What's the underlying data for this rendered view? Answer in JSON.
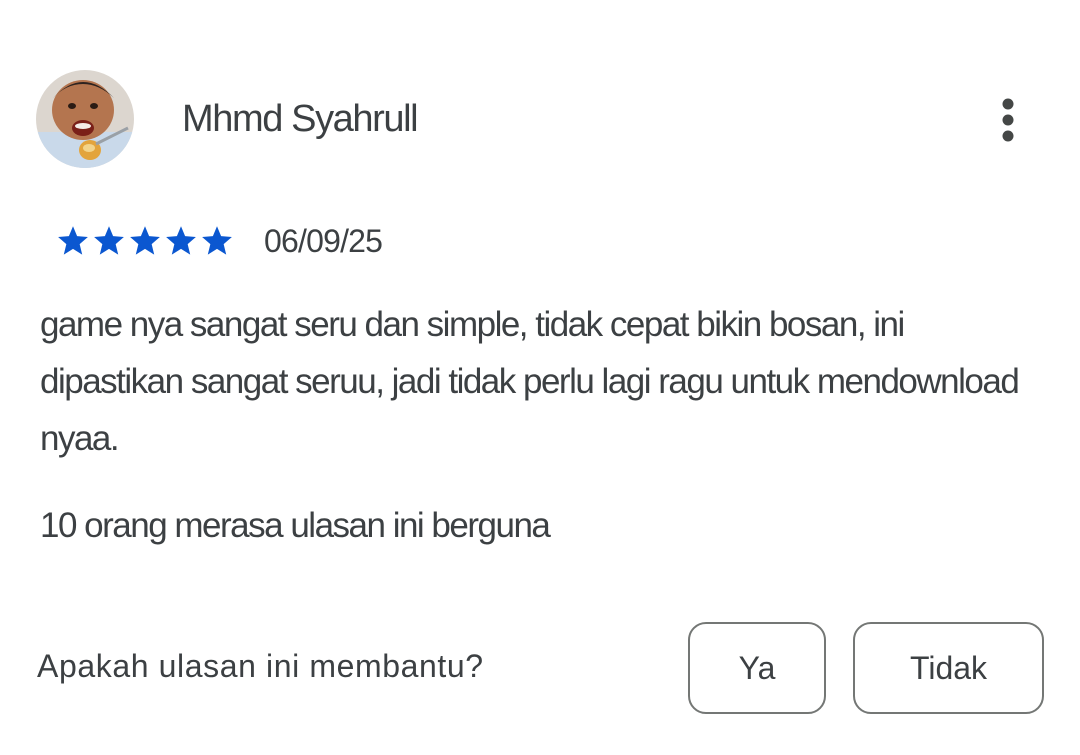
{
  "review": {
    "author_name": "Mhmd Syahrull",
    "rating": 5,
    "rating_max": 5,
    "date": "06/09/25",
    "text": "game nya sangat seru dan simple, tidak cepat bikin bosan, ini dipastikan sangat seruu, jadi tidak perlu lagi ragu untuk mendownload nyaa.",
    "helpful_count_text": "10 orang merasa ulasan ini berguna"
  },
  "feedback": {
    "question": "Apakah ulasan ini membantu?",
    "yes_label": "Ya",
    "no_label": "Tidak"
  },
  "icons": {
    "more": "more-vert-icon",
    "star": "star-icon"
  },
  "colors": {
    "star": "#0b57d0",
    "text": "#3c4043",
    "button_border": "#747775"
  }
}
